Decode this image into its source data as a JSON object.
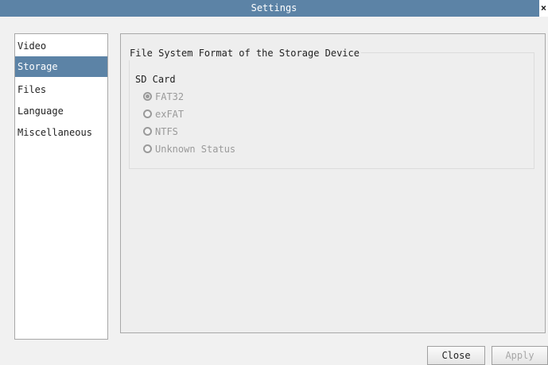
{
  "window": {
    "title": "Settings",
    "close_glyph": "×"
  },
  "sidebar": {
    "items": [
      {
        "label": "Video",
        "active": false
      },
      {
        "label": "Storage",
        "active": true
      },
      {
        "label": "Files",
        "active": false
      },
      {
        "label": "Language",
        "active": false
      },
      {
        "label": "Miscellaneous",
        "active": false
      }
    ]
  },
  "storage": {
    "group_title": "File System Format of the Storage Device",
    "device_label": "SD Card",
    "options": [
      {
        "label": "FAT32",
        "checked": true
      },
      {
        "label": "exFAT",
        "checked": false
      },
      {
        "label": "NTFS",
        "checked": false
      },
      {
        "label": "Unknown Status",
        "checked": false
      }
    ]
  },
  "footer": {
    "close_label": "Close",
    "apply_label": "Apply"
  },
  "colors": {
    "accent": "#5c83a6",
    "disabled_text": "#9a9a9a"
  }
}
